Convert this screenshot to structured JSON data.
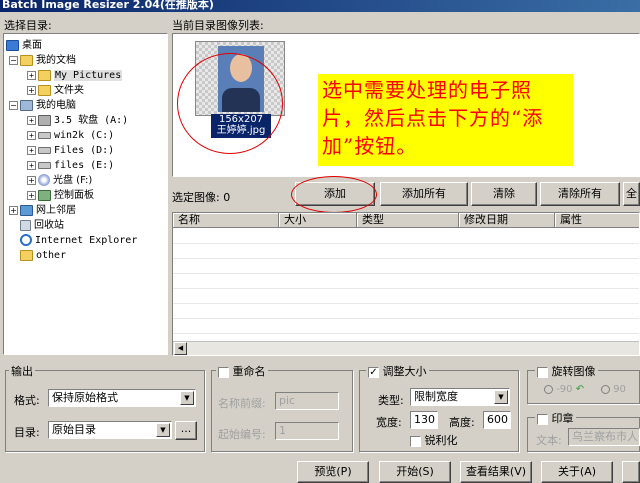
{
  "window": {
    "title": "Batch Image Resizer 2.04(在推版本)"
  },
  "left": {
    "label": "选择目录:"
  },
  "tree": [
    {
      "label": "桌面",
      "icon": "desktop-icon"
    },
    {
      "label": "我的文档",
      "icon": "folder-icon"
    },
    {
      "label": "My Pictures",
      "icon": "folder-icon"
    },
    {
      "label": "文件夹",
      "icon": "folder-icon"
    },
    {
      "label": "我的电脑",
      "icon": "computer-icon"
    },
    {
      "label": "3.5 软盘 (A:)",
      "icon": "floppy-icon"
    },
    {
      "label": "win2k (C:)",
      "icon": "drive-icon"
    },
    {
      "label": "Files (D:)",
      "icon": "drive-icon"
    },
    {
      "label": "files (E:)",
      "icon": "drive-icon"
    },
    {
      "label": "光盘 (F:)",
      "icon": "cdrom-icon"
    },
    {
      "label": "控制面板",
      "icon": "control-panel-icon"
    },
    {
      "label": "网上邻居",
      "icon": "network-icon"
    },
    {
      "label": "回收站",
      "icon": "recycle-bin-icon"
    },
    {
      "label": "Internet Explorer",
      "icon": "ie-icon"
    },
    {
      "label": "other",
      "icon": "folder-icon"
    }
  ],
  "preview": {
    "label": "当前目录图像列表:",
    "thumb_size": "156x207",
    "thumb_name": "王婷婷.jpg",
    "callout": "选中需要处理的电子照片，然后点击下方的“添加”按钮。"
  },
  "selected": {
    "label": "选定图像: 0",
    "buttons": {
      "add": "添加",
      "add_all": "添加所有",
      "remove": "清除",
      "remove_all": "清除所有",
      "more": "全"
    }
  },
  "table": {
    "columns": [
      "名称",
      "大小",
      "类型",
      "修改日期",
      "属性"
    ]
  },
  "output": {
    "legend": "输出",
    "format_label": "格式:",
    "format_value": "保持原始格式",
    "dir_label": "目录:",
    "dir_value": "原始目录",
    "browse": "..."
  },
  "rename": {
    "legend": "重命名",
    "prefix_label": "名称前缀:",
    "prefix_value": "pic",
    "start_label": "起始编号:",
    "start_value": "1"
  },
  "resize": {
    "legend": "调整大小",
    "type_label": "类型:",
    "type_value": "限制宽度",
    "width_label": "宽度:",
    "width_value": "130",
    "height_label": "高度:",
    "height_value": "600",
    "sharpen": "锐利化"
  },
  "rotate": {
    "legend": "旋转图像",
    "opt1": "-90",
    "opt2": "90"
  },
  "stamp": {
    "legend": "印章",
    "text_label": "文本:",
    "text_value": "乌兰察布市人"
  },
  "bottom": {
    "preview": "预览(P)",
    "start": "开始(S)",
    "view": "查看结果(V)",
    "about": "关于(A)"
  },
  "colors": {
    "callout_bg": "#ffff00",
    "callout_text": "#ff0000",
    "circle": "#e00000",
    "title_bg": "#0a246a"
  }
}
